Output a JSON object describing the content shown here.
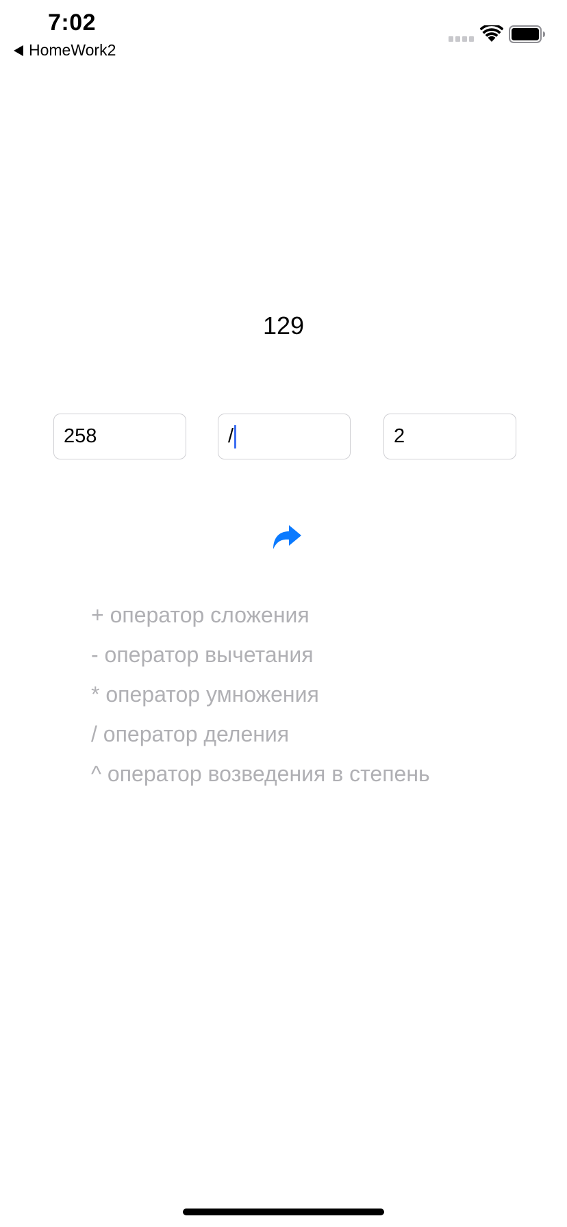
{
  "status_bar": {
    "time": "7:02",
    "back_app": "HomeWork2",
    "icons": [
      "cellular-signal-icon",
      "wifi-icon",
      "battery-icon"
    ]
  },
  "result": {
    "value": "129"
  },
  "inputs": {
    "operand_a": "258",
    "operator": "/",
    "operand_b": "2"
  },
  "calculate_button": {
    "icon": "share-arrow-icon",
    "color": "#0a7aff"
  },
  "help": {
    "items": [
      "+ оператор сложения",
      "- оператор вычетания",
      "* оператор умножения",
      "/ оператор деления",
      "^ оператор возведения в степень"
    ]
  },
  "colors": {
    "accent": "#0a7aff",
    "caret": "#3d6ef2",
    "help_text": "#b0b0b4"
  }
}
